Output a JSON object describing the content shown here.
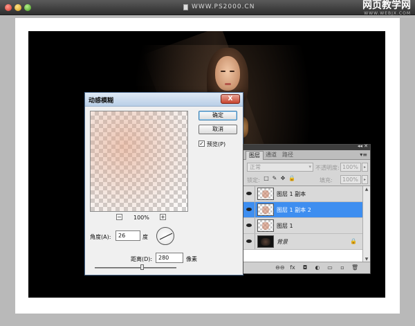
{
  "window": {
    "title": "WWW.PS2000.CN",
    "brand_main": "网页教学网",
    "brand_sub": "WWW.WEBJX.COM"
  },
  "dialog": {
    "title": "动感模糊",
    "close_label": "X",
    "ok_label": "确定",
    "cancel_label": "取消",
    "preview_label": "预览(P)",
    "preview_checked": "✓",
    "zoom_minus": "−",
    "zoom_plus": "+",
    "zoom_level": "100%",
    "angle_label": "角度(A):",
    "angle_value": "26",
    "angle_unit": "度",
    "distance_label": "距离(D):",
    "distance_value": "280",
    "distance_unit": "像素"
  },
  "layers_panel": {
    "strip_icons": "◂◂ ✕",
    "tabs": [
      {
        "label": "图层"
      },
      {
        "label": "通道"
      },
      {
        "label": "路径"
      }
    ],
    "menu_icon": "▾≡",
    "blend_mode": "正常",
    "blend_arrow": "▾",
    "opacity_label": "不透明度:",
    "opacity_value": "100%",
    "arrow": "▸",
    "lock_label": "锁定:",
    "fill_label": "填充:",
    "fill_value": "100%",
    "lock_icons": [
      "□",
      "✎",
      "✥",
      "🔒"
    ],
    "layers": [
      {
        "name": "图层 1 副本",
        "selected": false
      },
      {
        "name": "图层 1 副本 2",
        "selected": true
      },
      {
        "name": "图层 1",
        "selected": false
      },
      {
        "name": "背景",
        "selected": false,
        "locked": true
      }
    ],
    "lock_glyph": "🔒",
    "scroll_up": "▲",
    "scroll_down": "▼",
    "bottom_icons": [
      "⊖⊖",
      "fx",
      "◘",
      "◐",
      "▭",
      "▫",
      "🗑"
    ]
  }
}
